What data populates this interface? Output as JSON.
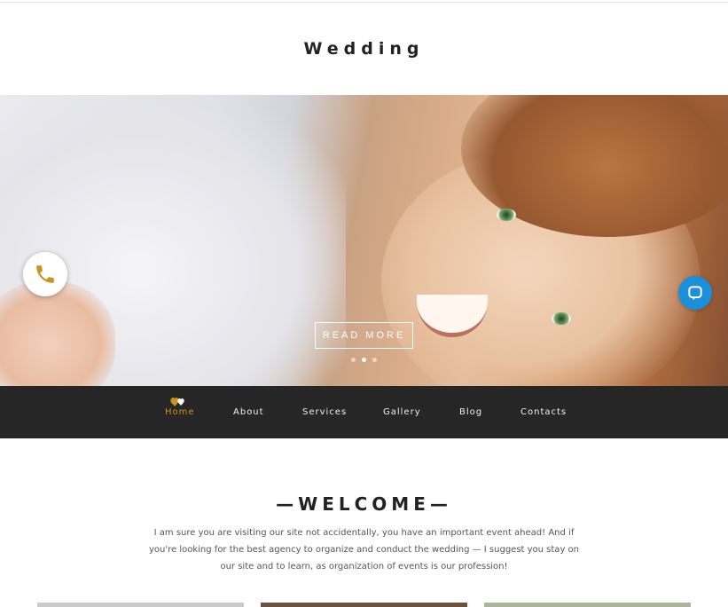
{
  "header": {
    "site_title": "Wedding"
  },
  "hero": {
    "read_more_label": "READ MORE",
    "slides_total": 3,
    "active_slide": 2
  },
  "nav": {
    "items": [
      {
        "label": "Home",
        "active": true
      },
      {
        "label": "About"
      },
      {
        "label": "Services"
      },
      {
        "label": "Gallery"
      },
      {
        "label": "Blog"
      },
      {
        "label": "Contacts"
      }
    ]
  },
  "welcome": {
    "title": "—WELCOME—",
    "text": "I am sure you are visiting our site not accidentally, you have an important event ahead! And if you're looking for the best agency to organize and conduct the wedding — I suggest you stay on our site and to learn, as organization of events is our profession!"
  },
  "colors": {
    "accent_gold": "#c8941a",
    "nav_background": "#262626",
    "chat_blue": "#1a8fdc"
  },
  "icons": {
    "phone": "phone-icon",
    "chat": "chat-icon",
    "nav_logo": "hearts-icon"
  }
}
